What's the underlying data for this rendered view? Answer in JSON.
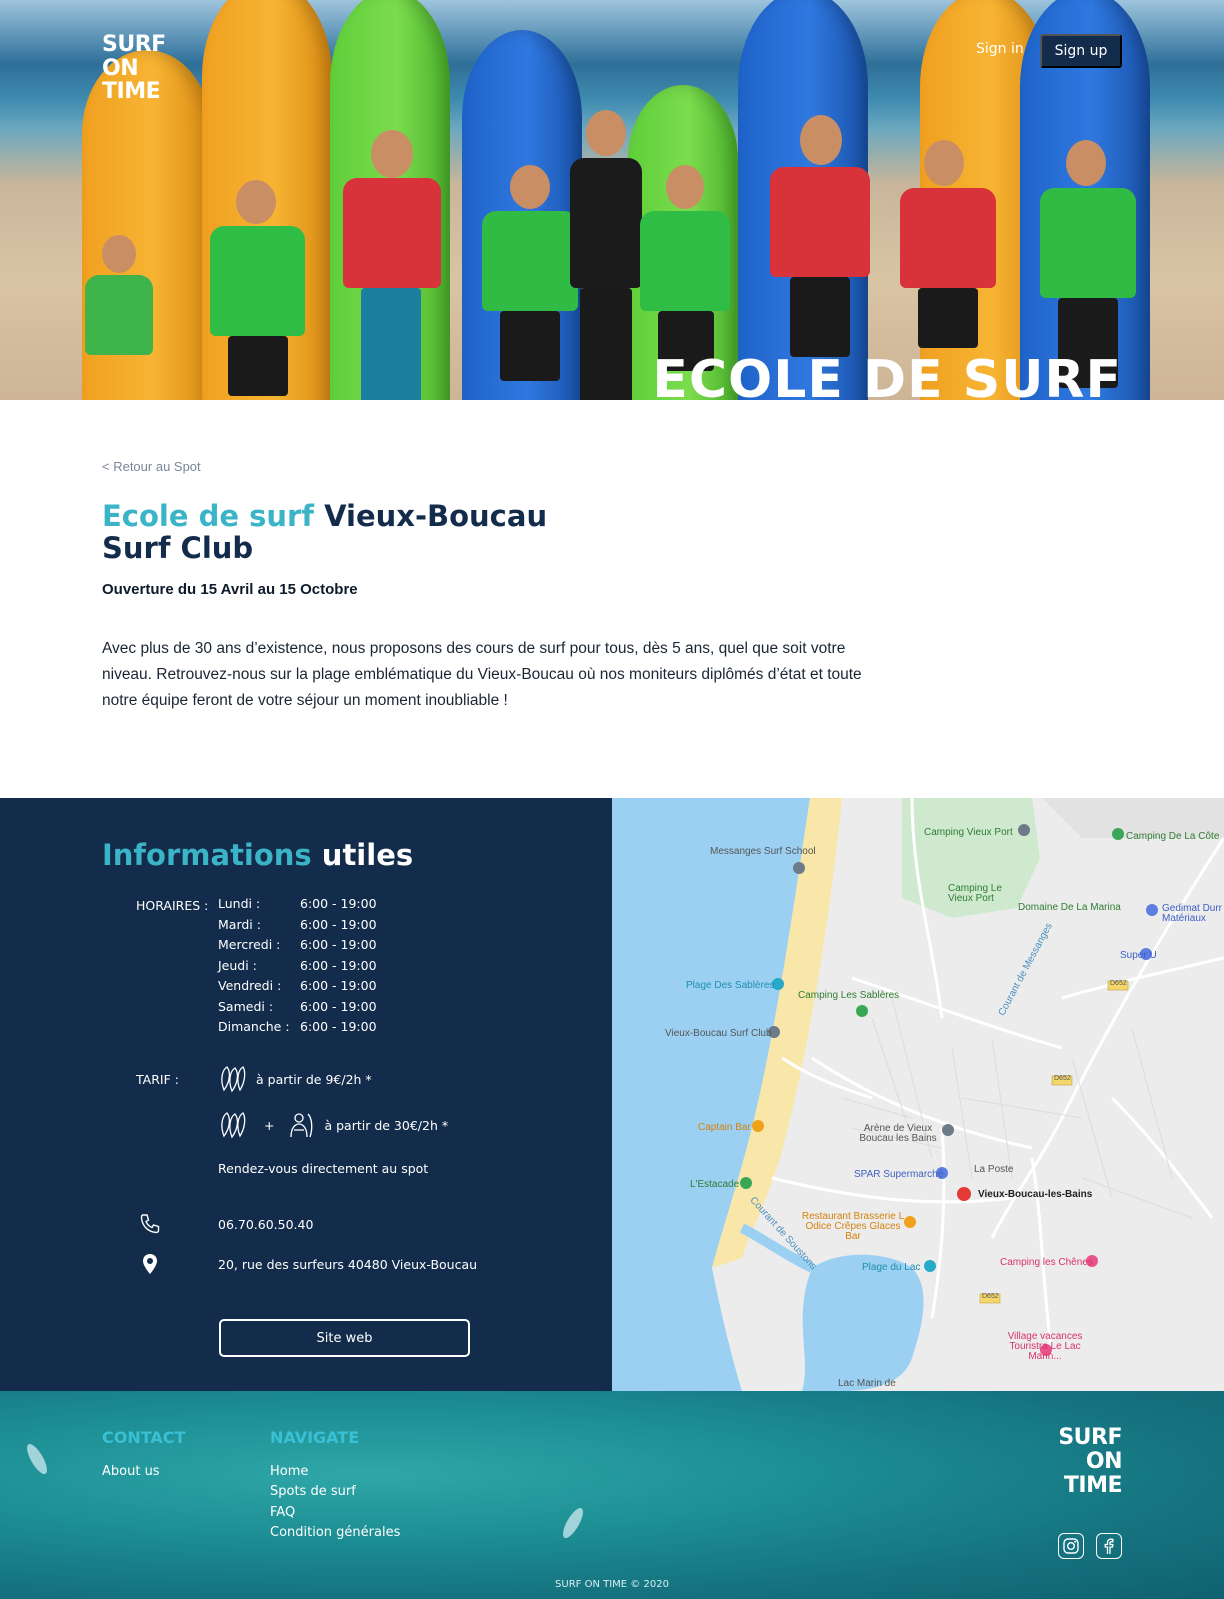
{
  "header": {
    "logo_line1": "SURF",
    "logo_line2": "ON",
    "logo_line3": "TIME",
    "signin_label": "Sign in",
    "signup_label": "Sign up",
    "hero_title": "ECOLE DE SURF"
  },
  "main": {
    "back_link": "< Retour au Spot",
    "title_accent": "Ecole de surf",
    "title_rest": " Vieux-Boucau Surf Club",
    "opening": "Ouverture du 15 Avril au 15 Octobre",
    "description": "Avec plus de 30 ans d’existence, nous proposons des cours de surf pour tous, dès 5 ans, quel que soit votre niveau. Retrouvez-nous sur la plage emblématique du Vieux-Boucau où nos moniteurs diplômés d’état et toute notre équipe feront de votre séjour un moment inoubliable !"
  },
  "info": {
    "title_accent": "Informations",
    "title_rest": " utiles",
    "hours_label": "HORAIRES :",
    "hours": [
      {
        "day": "Lundi :",
        "time": "6:00 - 19:00"
      },
      {
        "day": "Mardi :",
        "time": "6:00 - 19:00"
      },
      {
        "day": "Mercredi :",
        "time": "6:00 - 19:00"
      },
      {
        "day": "Jeudi :",
        "time": "6:00 - 19:00"
      },
      {
        "day": "Vendredi :",
        "time": "6:00 - 19:00"
      },
      {
        "day": "Samedi :",
        "time": "6:00 - 19:00"
      },
      {
        "day": "Dimanche :",
        "time": "6:00 - 19:00"
      }
    ],
    "tarif_label": "TARIF :",
    "tarif_board": "à partir de 9€/2h *",
    "tarif_plus": "+",
    "tarif_lesson": "à partir de 30€/2h *",
    "rendezvous": "Rendez-vous directement au spot",
    "phone": "06.70.60.50.40",
    "address": "20, rue des surfeurs 40480 Vieux-Boucau",
    "website_button": "Site web"
  },
  "map": {
    "labels": {
      "messanges_surf_school": "Messanges Surf School",
      "camping_vieux_port": "Camping Vieux Port",
      "camping_de_la_cote": "Camping De La Côte",
      "camping_le_vieux_port": "Camping Le Vieux Port",
      "domaine_marina": "Domaine De La Marina",
      "gedimat": "Gedimat Durr Matériaux",
      "super_u": "Super U",
      "plage_sableres": "Plage Des Sablères",
      "camping_sableres": "Camping Les Sablères",
      "vieux_boucau_surf_club": "Vieux-Boucau Surf Club",
      "captain_bar": "Captain Bar",
      "arene": "Arène de Vieux Boucau les Bains",
      "la_poste": "La Poste",
      "spar": "SPAR Supermarché",
      "vieux_boucau_les_bains": "Vieux-Boucau-les-Bains",
      "estacade": "L'Estacade",
      "restaurant": "Restaurant Brasserie L Odice Crêpes Glaces Bar",
      "plage_du_lac": "Plage du Lac",
      "camping_chenes": "Camping les Chênes",
      "village_vacances": "Village vacances Touristra Le Lac Marin...",
      "lac_marin": "Lac Marin de",
      "courant_soustons": "Courant de Soustons",
      "courant_messanges": "Courant de Messanges",
      "d652": "D652"
    }
  },
  "footer": {
    "contact_title": "CONTACT",
    "contact_links": [
      "About us"
    ],
    "navigate_title": "NAVIGATE",
    "navigate_links": [
      "Home",
      "Spots de surf",
      "FAQ",
      "Condition générales"
    ],
    "logo_line1": "SURF",
    "logo_line2": "ON",
    "logo_line3": "TIME",
    "copyright": "SURF ON TIME © 2020",
    "social": [
      "instagram-icon",
      "facebook-icon"
    ]
  },
  "colors": {
    "navy": "#142c4c",
    "accent": "#3ab4c6",
    "footer_teal": "#1d8f95"
  }
}
